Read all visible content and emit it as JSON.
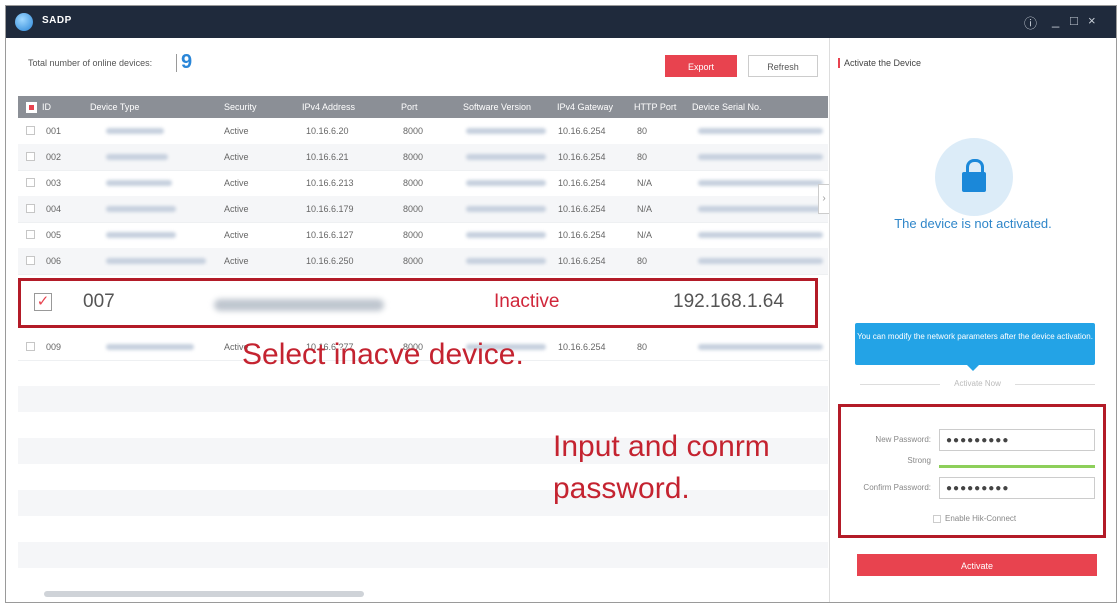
{
  "app": {
    "title": "SADP"
  },
  "window_controls": {
    "info": "ⓘ",
    "minimize": "_",
    "maximize": "□",
    "close": "×"
  },
  "left": {
    "total_label": "Total number of online devices:",
    "total_count": "9",
    "export_label": "Export",
    "refresh_label": "Refresh"
  },
  "table": {
    "headers": [
      "ID",
      "Device Type",
      "Security",
      "IPv4 Address",
      "Port",
      "Software Version",
      "IPv4 Gateway",
      "HTTP Port",
      "Device Serial No."
    ],
    "rows": [
      {
        "id": "001",
        "security": "Active",
        "ip": "10.16.6.20",
        "port": "8000",
        "gateway": "10.16.6.254",
        "http": "80"
      },
      {
        "id": "002",
        "security": "Active",
        "ip": "10.16.6.21",
        "port": "8000",
        "gateway": "10.16.6.254",
        "http": "80"
      },
      {
        "id": "003",
        "security": "Active",
        "ip": "10.16.6.213",
        "port": "8000",
        "gateway": "10.16.6.254",
        "http": "N/A"
      },
      {
        "id": "004",
        "security": "Active",
        "ip": "10.16.6.179",
        "port": "8000",
        "gateway": "10.16.6.254",
        "http": "N/A"
      },
      {
        "id": "005",
        "security": "Active",
        "ip": "10.16.6.127",
        "port": "8000",
        "gateway": "10.16.6.254",
        "http": "N/A"
      },
      {
        "id": "006",
        "security": "Active",
        "ip": "10.16.6.250",
        "port": "8000",
        "gateway": "10.16.6.254",
        "http": "80"
      }
    ],
    "row_009": {
      "id": "009",
      "security": "Active",
      "ip": "10.16.6.?77",
      "port": "8000",
      "gateway": "10.16.6.254",
      "http": "80"
    },
    "selected": {
      "id": "007",
      "status": "Inactive",
      "ip": "192.168.1.64"
    }
  },
  "captions": {
    "select": "Select inacve device.",
    "input": "Input and conrm password."
  },
  "right": {
    "title": "Activate the Device",
    "not_activated": "The device is not activated.",
    "tip": "You can modify the network parameters after the device activation.",
    "activate_now": "Activate Now",
    "new_password_label": "New Password:",
    "new_password_value": "●●●●●●●●●",
    "strength": "Strong",
    "confirm_password_label": "Confirm Password:",
    "confirm_password_value": "●●●●●●●●●",
    "hik_connect": "Enable Hik-Connect",
    "activate_button": "Activate"
  },
  "colors": {
    "accent_red": "#e8434f",
    "brand_blue": "#2a86d8",
    "titlebar": "#1f2a3c",
    "highlight_red": "#b31b28"
  }
}
